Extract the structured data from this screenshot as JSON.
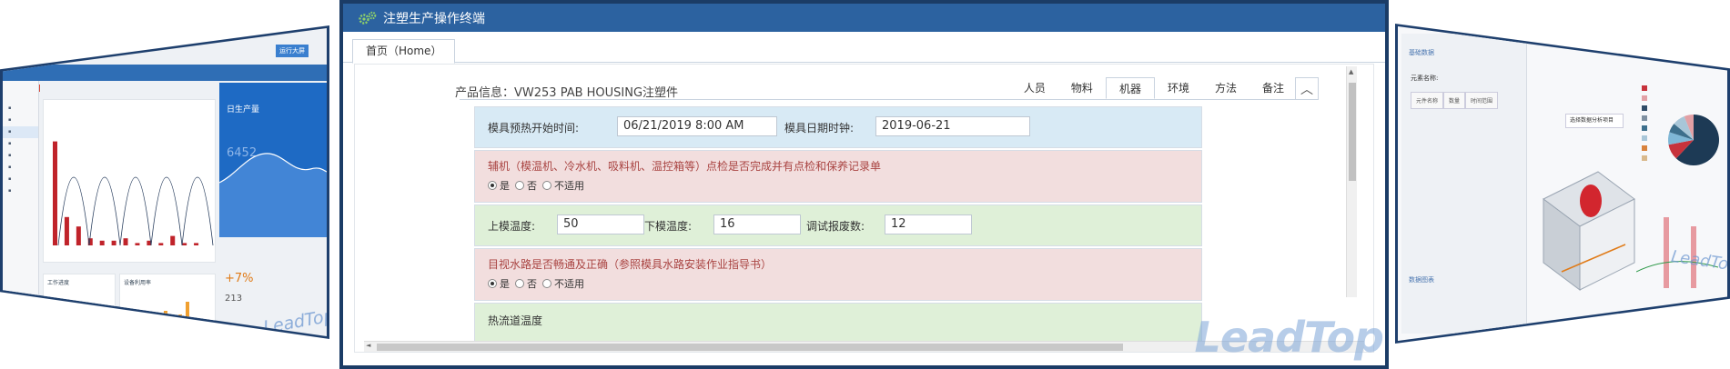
{
  "left_screen": {
    "corner_title": "运行大屏",
    "blue_panel": {
      "title": "日生产量",
      "value": "6452"
    },
    "cards": [
      "工作进度",
      "设备利用率"
    ],
    "growth": "+7%",
    "count": "213",
    "logo": "LeadTop",
    "chart": {
      "type": "bar",
      "values": [
        44,
        12,
        8,
        3,
        2,
        2,
        3,
        1,
        2,
        1,
        4,
        1,
        1
      ]
    }
  },
  "main": {
    "window_title": "注塑生产操作终端",
    "home_tab": "首页（Home）",
    "product_info": "产品信息：VW253 PAB HOUSING注塑件",
    "subtabs": [
      "人员",
      "物料",
      "机器",
      "环境",
      "方法",
      "备注"
    ],
    "active_subtab": "机器",
    "collapse_icon": "chevron-up-icon",
    "fields": {
      "preheat_start_label": "模具预热开始时间:",
      "preheat_start_value": "06/21/2019 8:00 AM",
      "mold_date_label": "模具日期时钟:",
      "mold_date_value": "2019-06-21",
      "upper_temp_label": "上模温度:",
      "upper_temp_value": "50",
      "lower_temp_label": "下模温度:",
      "lower_temp_value": "16",
      "debug_scrap_label": "调试报废数:",
      "debug_scrap_value": "12",
      "hot_runner_label": "热流道温度"
    },
    "questions": [
      {
        "text": "辅机（模温机、冷水机、吸料机、温控箱等）点检是否完成并有点检和保养记录单",
        "selected": "是"
      },
      {
        "text": "目视水路是否畅通及正确（参照模具水路安装作业指导书）",
        "selected": "是"
      }
    ],
    "radio_options": [
      "是",
      "否",
      "不适用"
    ],
    "logo": "LeadTop"
  },
  "right_screen": {
    "sidebar_header": "基础数据",
    "sidebar_label": "元素名称:",
    "sidebar_tabs": [
      "元件名称",
      "数量",
      "时间范围"
    ],
    "sidebar_footer": "数据图表",
    "dropdown": "选择数据分析项目",
    "legend_colors": [
      "#c7323b",
      "#e2a0a5",
      "#2f4b66",
      "#7e8fa0",
      "#3d6f8c",
      "#a8c6d8",
      "#d8823c",
      "#d9b98c"
    ],
    "pie": {
      "type": "pie",
      "values": [
        62,
        10,
        8,
        6,
        8,
        6
      ]
    },
    "logo": "LeadTop"
  }
}
